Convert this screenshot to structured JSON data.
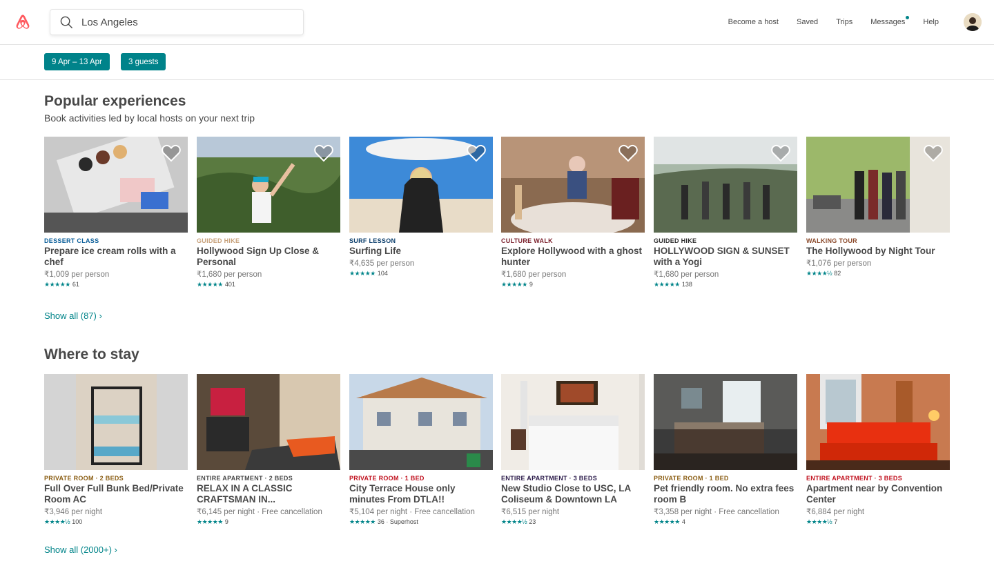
{
  "search": {
    "value": "Los Angeles"
  },
  "nav": {
    "become_host": "Become a host",
    "saved": "Saved",
    "trips": "Trips",
    "messages": "Messages",
    "help": "Help"
  },
  "filters": {
    "dates": "9 Apr – 13 Apr",
    "guests": "3 guests"
  },
  "experiences": {
    "title": "Popular experiences",
    "subtitle": "Book activities led by local hosts on your next trip",
    "show_all": "Show all (87)",
    "cards": [
      {
        "category": "DESSERT CLASS",
        "cat_color": "#0a5e99",
        "name": "Prepare ice cream rolls with a chef",
        "price": "₹1,009 per person",
        "stars": "★★★★★",
        "count": "61"
      },
      {
        "category": "GUIDED HIKE",
        "cat_color": "#c7a17a",
        "name": "Hollywood Sign Up Close & Personal",
        "price": "₹1,680 per person",
        "stars": "★★★★★",
        "count": "401"
      },
      {
        "category": "SURF LESSON",
        "cat_color": "#0a3d6b",
        "name": "Surfing Life",
        "price": "₹4,635 per person",
        "stars": "★★★★★",
        "count": "104"
      },
      {
        "category": "CULTURE WALK",
        "cat_color": "#7a1f2b",
        "name": "Explore Hollywood with a ghost hunter",
        "price": "₹1,680 per person",
        "stars": "★★★★★",
        "count": "9"
      },
      {
        "category": "GUIDED HIKE",
        "cat_color": "#2c2c2c",
        "name": "HOLLYWOOD SIGN & SUNSET with a Yogi",
        "price": "₹1,680 per person",
        "stars": "★★★★★",
        "count": "138"
      },
      {
        "category": "WALKING TOUR",
        "cat_color": "#8b4a2b",
        "name": "The Hollywood by Night Tour",
        "price": "₹1,076 per person",
        "stars": "★★★★½",
        "count": "82"
      }
    ]
  },
  "stays": {
    "title": "Where to stay",
    "show_all": "Show all (2000+)",
    "cards": [
      {
        "category": "PRIVATE ROOM · 2 BEDS",
        "cat_color": "#8b5e14",
        "name": "Full Over Full Bunk Bed/Private Room AC",
        "price": "₹3,946",
        "per": " per night",
        "extra": "",
        "stars": "★★★★½",
        "count": "100"
      },
      {
        "category": "ENTIRE APARTMENT · 2 BEDS",
        "cat_color": "#484848",
        "name": "RELAX IN A CLASSIC CRAFTSMAN IN...",
        "price": "₹6,145",
        "per": " per night · Free cancellation",
        "extra": "",
        "stars": "★★★★★",
        "count": "9"
      },
      {
        "category": "PRIVATE ROOM · 1 BED",
        "cat_color": "#c1121f",
        "name": "City Terrace House only minutes From DTLA!!",
        "price": "₹5,104",
        "per": " per night · Free cancellation",
        "extra": " · Superhost",
        "stars": "★★★★★",
        "count": "36"
      },
      {
        "category": "ENTIRE APARTMENT · 3 BEDS",
        "cat_color": "#2a1a4a",
        "name": "New Studio Close to USC, LA Coliseum & Downtown LA",
        "price": "₹6,515",
        "per": " per night",
        "extra": "",
        "stars": "★★★★½",
        "count": "23"
      },
      {
        "category": "PRIVATE ROOM · 1 BED",
        "cat_color": "#8b5e14",
        "name": "Pet friendly room. No extra fees room B",
        "price": "₹3,358",
        "per": " per night · Free cancellation",
        "extra": "",
        "stars": "★★★★★",
        "count": "4"
      },
      {
        "category": "ENTIRE APARTMENT · 3 BEDS",
        "cat_color": "#c1121f",
        "name": "Apartment near by Convention Center",
        "price": "₹6,884",
        "per": " per night",
        "extra": "",
        "stars": "★★★★½",
        "count": "7"
      }
    ]
  }
}
